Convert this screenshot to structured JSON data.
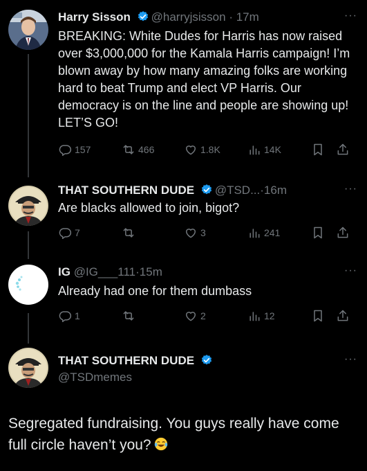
{
  "tweets": [
    {
      "name": "Harry Sisson",
      "handle": "@harryjsisson",
      "dot": "·",
      "time": "17m",
      "text": "BREAKING: White Dudes for Harris has now raised over $3,000,000 for the Kamala Harris campaign! I’m blown away by how many amazing folks are working hard to beat Trump and elect VP Harris. Our democracy is on the line and people are showing up! LET’S GO!",
      "replies": "157",
      "retweets": "466",
      "likes": "1.8K",
      "views": "14K"
    },
    {
      "name": "THAT SOUTHERN DUDE",
      "handle": "@TSD...",
      "dot": "·",
      "time": "16m",
      "text": "Are blacks allowed to join, bigot?",
      "replies": "7",
      "retweets": "",
      "likes": "3",
      "views": "241"
    },
    {
      "name": "IG",
      "handle": "@IG___111",
      "dot": "·",
      "time": "15m",
      "text": "Already had one for them dumbass",
      "replies": "1",
      "retweets": "",
      "likes": "2",
      "views": "12"
    }
  ],
  "main": {
    "name": "THAT SOUTHERN DUDE",
    "handle": "@TSDmemes",
    "text": "Segregated fundraising. You guys really have come full circle haven’t you?"
  },
  "more_label": "···",
  "colors": {
    "background": "#000000",
    "text": "#e7e9ea",
    "muted": "#71767b",
    "verified": "#1d9bf0"
  }
}
